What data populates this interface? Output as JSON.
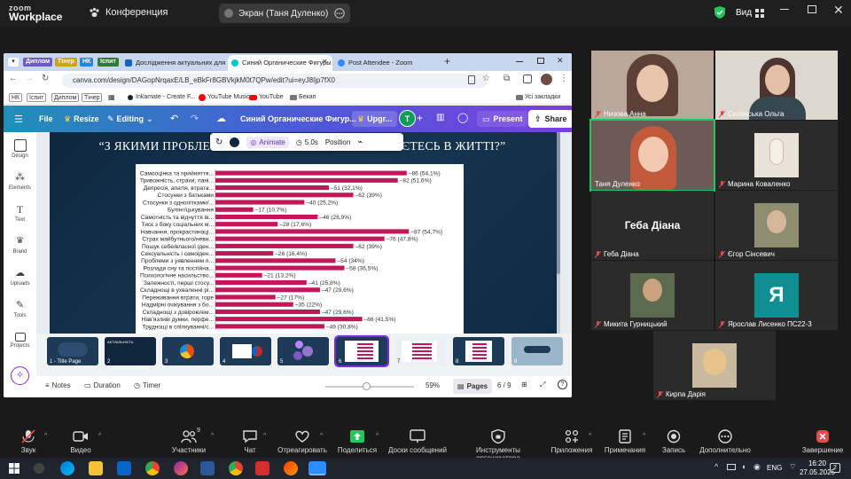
{
  "zoom": {
    "logo_line1": "zoom",
    "logo_line2": "Workplace",
    "meeting_label": "Конференция",
    "share_pill": "Экран (Таня Дуленко)",
    "view_label": "Вид"
  },
  "browser": {
    "tab_chips": [
      "Диплом",
      "Тінер",
      "НК",
      "Іспит"
    ],
    "tabs": [
      {
        "label": "Дослідження актуальних для"
      },
      {
        "label": "Синий Органические Фигуры"
      },
      {
        "label": "Post Attendee - Zoom"
      }
    ],
    "url": "canva.com/design/DAGopNrqaxE/LB_eBkFr8GBVkjkM0t7QPw/edit?ui=eyJ8Ijp7fX0",
    "bookmarks": [
      "НК",
      "Іспит",
      "Диплом",
      "Тінер",
      "Inkamate - Create F...",
      "YouTube Music",
      "YouTube",
      "Бекап"
    ],
    "all_bookmarks": "Усі закладки"
  },
  "canva": {
    "file": "File",
    "resize": "Resize",
    "editing": "Editing",
    "doc_title": "Синий Органические Фигур...",
    "upgrade": "Upgr...",
    "avatar_letter": "T",
    "present": "Present",
    "share": "Share",
    "left_items": [
      "Design",
      "Elements",
      "Text",
      "Brand",
      "Uploads",
      "Tools",
      "Projects"
    ],
    "toolbar": {
      "animate": "Animate",
      "duration": "5.0s",
      "position": "Position"
    },
    "slide_title": "“З ЯКИМИ ПРОБЛЕМАМИ ВИ НАЙЧАСТІШЕ СТИКАЄТЕСЬ В ЖИТТІ?”",
    "thumbs": [
      {
        "label": "1 - Title Page",
        "title": ""
      },
      {
        "label": "2",
        "title": "АКТУАЛЬНІСТЬ"
      },
      {
        "label": "3",
        "title": ""
      },
      {
        "label": "4",
        "title": ""
      },
      {
        "label": "5",
        "title": ""
      },
      {
        "label": "6",
        "title": ""
      },
      {
        "label": "7",
        "title": ""
      },
      {
        "label": "8",
        "title": ""
      },
      {
        "label": "9",
        "title": ""
      }
    ],
    "bottom": {
      "notes": "Notes",
      "duration": "Duration",
      "timer": "Timer",
      "zoom": "59%",
      "pages": "Pages",
      "page_counter": "6 / 9"
    }
  },
  "chart_data": {
    "type": "bar",
    "orientation": "horizontal",
    "categories": [
      "Самооцінка та прийняття...",
      "Тривожність, страхи, пані...",
      "Депресія, апатія, втрата...",
      "Стосунки з батьками",
      "Стосунки з однолітками/...",
      "Булінг/цькування",
      "Самотність та відчуття ів...",
      "Тиск з боку соціальних м...",
      "Навчання, прокрастинаці...",
      "Страх майбутнього/неви...",
      "Пошук себе/власної іден...",
      "Сексуальність і самоіден...",
      "Проблеми з уявленням п...",
      "Розлади сну та постійна...",
      "Психологічне насильство...",
      "Залежності, перші стосу...",
      "Складнощі в ухваленні рі...",
      "Переживання втрати, горе",
      "Надмірні очікування з бо...",
      "Складнощі з довірою/ем...",
      "Нав'язливі думки, перфе...",
      "Труднощі в спілкуванні/с..."
    ],
    "values": [
      86,
      82,
      51,
      62,
      40,
      17,
      46,
      28,
      87,
      76,
      62,
      26,
      54,
      58,
      21,
      41,
      47,
      27,
      35,
      47,
      66,
      49
    ],
    "value_labels": [
      "86 (54,1%)",
      "82 (51,6%)",
      "51 (32,1%)",
      "62 (39%)",
      "40 (25,2%)",
      "17 (10,7%)",
      "46 (28,9%)",
      "28 (17,6%)",
      "87 (54,7%)",
      "76 (47,8%)",
      "62 (39%)",
      "26 (16,4%)",
      "54 (34%)",
      "58 (36,5%)",
      "21 (13,2%)",
      "41 (25,8%)",
      "47 (29,6%)",
      "27 (17%)",
      "35 (22%)",
      "47 (29,6%)",
      "66 (41,5%)",
      "49 (30,8%)"
    ],
    "bar_color": "#c2185b",
    "xlim": [
      0,
      110
    ]
  },
  "participants": [
    {
      "name": "Низова Анна",
      "muted": true
    },
    {
      "name": "Склянська Ольга",
      "muted": true
    },
    {
      "name": "Таня Дуленко",
      "muted": false
    },
    {
      "name": "Марина Коваленко",
      "muted": true
    },
    {
      "name": "Геба Діана",
      "muted": true,
      "big_name": "Геба Діана"
    },
    {
      "name": "Єгор Сінсевич",
      "muted": true
    },
    {
      "name": "Микита Гурницький",
      "muted": true
    },
    {
      "name": "Ярослав Лисенко ПС22-3",
      "muted": true,
      "avatar_letter": "Я"
    },
    {
      "name": "Кирпа Дарія",
      "muted": true
    }
  ],
  "bottom_bar": [
    {
      "label": "Звук",
      "icon": "mic-off-icon"
    },
    {
      "label": "Видео",
      "icon": "video-icon"
    },
    {
      "label": "Участники",
      "icon": "participants-icon",
      "count": "9"
    },
    {
      "label": "Чат",
      "icon": "chat-icon"
    },
    {
      "label": "Отреагировать",
      "icon": "react-icon"
    },
    {
      "label": "Поделиться",
      "icon": "share-icon"
    },
    {
      "label": "Доски сообщений",
      "icon": "whiteboard-icon"
    },
    {
      "label": "Инструменты организатора",
      "icon": "shield-icon"
    },
    {
      "label": "Приложения",
      "icon": "apps-icon"
    },
    {
      "label": "Примечания",
      "icon": "notes-icon"
    },
    {
      "label": "Запись",
      "icon": "record-icon"
    },
    {
      "label": "Дополнительно",
      "icon": "more-icon"
    },
    {
      "label": "Завершение",
      "icon": "end-icon"
    }
  ],
  "taskbar": {
    "lang": "ENG",
    "time": "16:20",
    "date": "27.05.2025",
    "notif_count": "2"
  },
  "colors": {
    "canva_purple": "#7d2ae8",
    "zoom_green": "#22c55e",
    "end_red": "#e5484d",
    "bar": "#c2185b"
  }
}
